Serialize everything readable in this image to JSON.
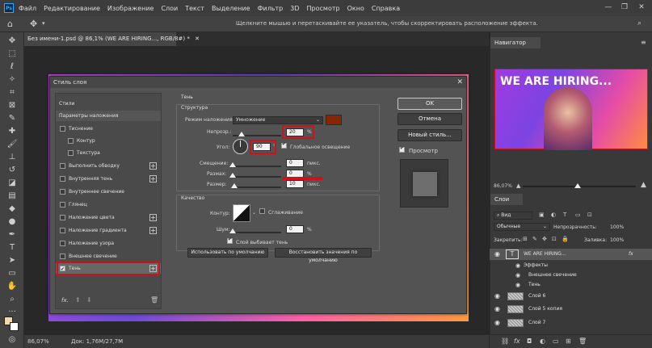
{
  "menu": {
    "logo": "Ps",
    "items": [
      "Файл",
      "Редактирование",
      "Изображение",
      "Слои",
      "Текст",
      "Выделение",
      "Фильтр",
      "3D",
      "Просмотр",
      "Окно",
      "Справка"
    ]
  },
  "options_bar": {
    "hint": "Щелкните мышью и перетаскивайте ее указатель, чтобы скорректировать расположение эффекта."
  },
  "document": {
    "tab_title": "Без имени-1.psd @ 86,1% (WE ARE HIRING..., RGB/8#) *",
    "zoom": "86,07%",
    "doc_info": "Док: 1,76M/27,7M"
  },
  "dialog": {
    "title": "Стиль слоя",
    "styles": [
      {
        "label": "Стили",
        "checkbox": false,
        "plus": false
      },
      {
        "label": "Параметры наложения",
        "checkbox": false,
        "plus": false
      },
      {
        "label": "Тиснение",
        "checkbox": true,
        "checked": false,
        "plus": false
      },
      {
        "label": "Контур",
        "checkbox": true,
        "checked": false,
        "plus": false,
        "indent": true
      },
      {
        "label": "Текстура",
        "checkbox": true,
        "checked": false,
        "plus": false,
        "indent": true
      },
      {
        "label": "Выполнить обводку",
        "checkbox": true,
        "checked": false,
        "plus": true
      },
      {
        "label": "Внутренняя тень",
        "checkbox": true,
        "checked": false,
        "plus": true
      },
      {
        "label": "Внутреннее свечение",
        "checkbox": true,
        "checked": false,
        "plus": false
      },
      {
        "label": "Глянец",
        "checkbox": true,
        "checked": false,
        "plus": false
      },
      {
        "label": "Наложение цвета",
        "checkbox": true,
        "checked": false,
        "plus": true
      },
      {
        "label": "Наложение градиента",
        "checkbox": true,
        "checked": false,
        "plus": true
      },
      {
        "label": "Наложение узора",
        "checkbox": true,
        "checked": false,
        "plus": false
      },
      {
        "label": "Внешнее свечение",
        "checkbox": true,
        "checked": false,
        "plus": false
      },
      {
        "label": "Тень",
        "checkbox": true,
        "checked": true,
        "plus": true,
        "active": true
      }
    ],
    "list_footer_fx": "fx.",
    "shadow": {
      "section": "Тень",
      "structure": "Структура",
      "blend_mode_label": "Режим наложения:",
      "blend_mode_value": "Умножение",
      "shadow_color": "#8b2500",
      "opacity_label": "Непрозр.:",
      "opacity_value": "20",
      "opacity_unit": "%",
      "angle_label": "Угол:",
      "angle_value": "90",
      "angle_unit": "°",
      "global_light_label": "Глобальное освещение",
      "distance_label": "Смещение:",
      "distance_value": "0",
      "distance_unit": "пикс.",
      "spread_label": "Размах:",
      "spread_value": "0",
      "spread_unit": "%",
      "size_label": "Размер:",
      "size_value": "10",
      "size_unit": "пикс.",
      "quality": "Качество",
      "contour_label": "Контур:",
      "antialias_label": "Сглаживание",
      "noise_label": "Шум:",
      "noise_value": "0",
      "noise_unit": "%",
      "knockout_label": "Слой выбивает тень",
      "make_default": "Использовать по умолчанию",
      "reset_default": "Восстановить значения по умолчанию"
    },
    "buttons": {
      "ok": "OK",
      "cancel": "Отмена",
      "new_style": "Новый стиль...",
      "preview": "Просмотр"
    }
  },
  "navigator": {
    "tab": "Навигатор",
    "image_text": "WE ARE HIRING...",
    "zoom": "86,07%"
  },
  "layers": {
    "tab": "Слои",
    "kind_filter": "Вид",
    "blend": "Обычные",
    "opacity_label": "Непрозрачность:",
    "opacity_value": "100%",
    "lock_label": "Закрепить:",
    "fill_label": "Заливка:",
    "fill_value": "100%",
    "items": [
      {
        "name": "WE ARE HIRING...",
        "type": "text",
        "fx": "fx"
      },
      {
        "name": "Эффекты",
        "type": "sub"
      },
      {
        "name": "Внешнее свечение",
        "type": "sub"
      },
      {
        "name": "Тень",
        "type": "sub"
      },
      {
        "name": "Слой 6",
        "type": "layer"
      },
      {
        "name": "Слой 5 копия",
        "type": "layer"
      },
      {
        "name": "Слой 7",
        "type": "layer"
      }
    ]
  }
}
